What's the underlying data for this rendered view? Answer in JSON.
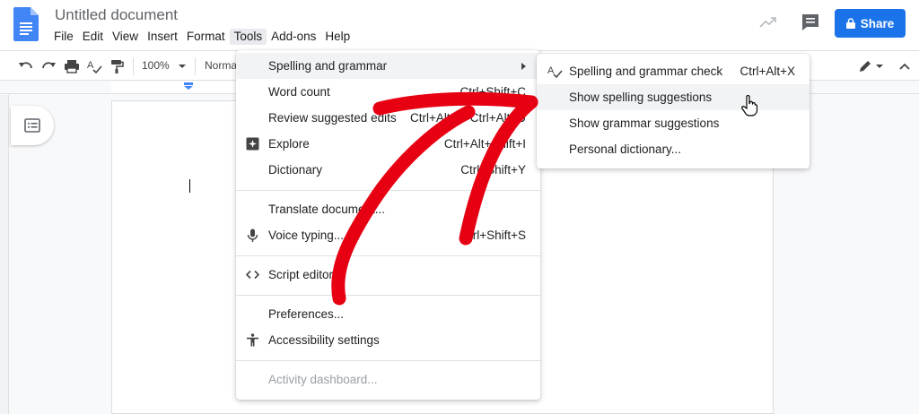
{
  "header": {
    "title": "Untitled document",
    "menus": [
      "File",
      "Edit",
      "View",
      "Insert",
      "Format",
      "Tools",
      "Add-ons",
      "Help"
    ],
    "share_label": "Share"
  },
  "toolbar": {
    "zoom": "100%",
    "style": "Normal"
  },
  "tools_menu": {
    "items": [
      {
        "label": "Spelling and grammar",
        "shortcut": ""
      },
      {
        "label": "Word count",
        "shortcut": "Ctrl+Shift+C"
      },
      {
        "label": "Review suggested edits",
        "shortcut": "Ctrl+Alt+O Ctrl+Alt+U"
      },
      {
        "label": "Explore",
        "shortcut": "Ctrl+Alt+Shift+I"
      },
      {
        "label": "Dictionary",
        "shortcut": "Ctrl+Shift+Y"
      },
      {
        "label": "Translate document...",
        "shortcut": ""
      },
      {
        "label": "Voice typing...",
        "shortcut": "Ctrl+Shift+S"
      },
      {
        "label": "Script editor",
        "shortcut": ""
      },
      {
        "label": "Preferences...",
        "shortcut": ""
      },
      {
        "label": "Accessibility settings",
        "shortcut": ""
      },
      {
        "label": "Activity dashboard...",
        "shortcut": ""
      }
    ]
  },
  "submenu": {
    "items": [
      {
        "label": "Spelling and grammar check",
        "shortcut": "Ctrl+Alt+X"
      },
      {
        "label": "Show spelling suggestions",
        "shortcut": ""
      },
      {
        "label": "Show grammar suggestions",
        "shortcut": ""
      },
      {
        "label": "Personal dictionary...",
        "shortcut": ""
      }
    ]
  },
  "colors": {
    "accent": "#1a73e8",
    "annotation": "#e60012",
    "doc_icon": "#4285f4"
  }
}
